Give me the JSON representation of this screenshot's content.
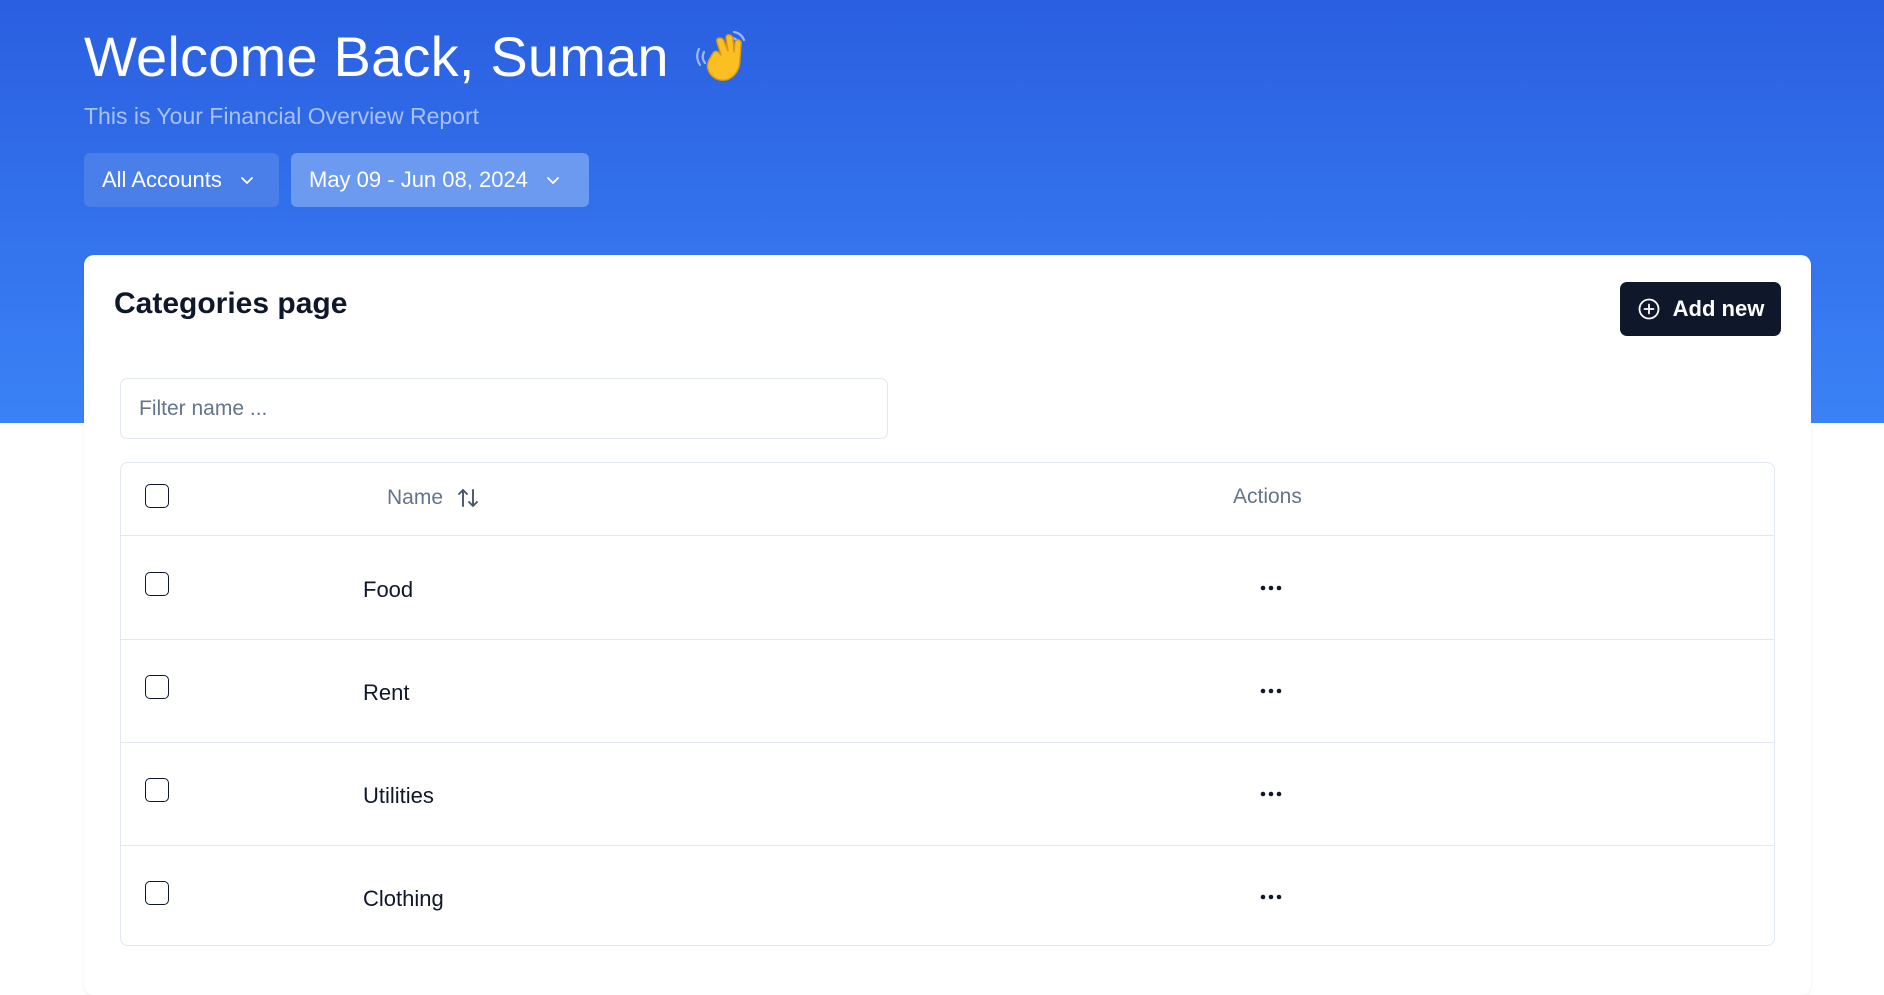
{
  "header": {
    "greeting": "Welcome Back, Suman",
    "subtitle": "This is Your Financial Overview Report",
    "accounts_label": "All Accounts",
    "date_range_label": "May 09 - Jun 08, 2024"
  },
  "card": {
    "title": "Categories page",
    "add_button_label": "Add new",
    "filter_placeholder": "Filter name ..."
  },
  "table": {
    "columns": {
      "name": "Name",
      "actions": "Actions"
    },
    "rows": [
      {
        "name": "Food"
      },
      {
        "name": "Rent"
      },
      {
        "name": "Utilities"
      },
      {
        "name": "Clothing"
      }
    ]
  },
  "icons": {
    "wave": "waving-hand-icon",
    "chevron": "chevron-down-icon",
    "add": "plus-circle-icon",
    "sort": "sort-arrows-icon",
    "more": "more-horizontal-icon"
  },
  "colors": {
    "hero_top": "#2a5fe0",
    "hero_bottom": "#3b82f6",
    "primary_button": "#0f172a",
    "muted_text": "#64748b",
    "border": "#e2e8f0"
  }
}
